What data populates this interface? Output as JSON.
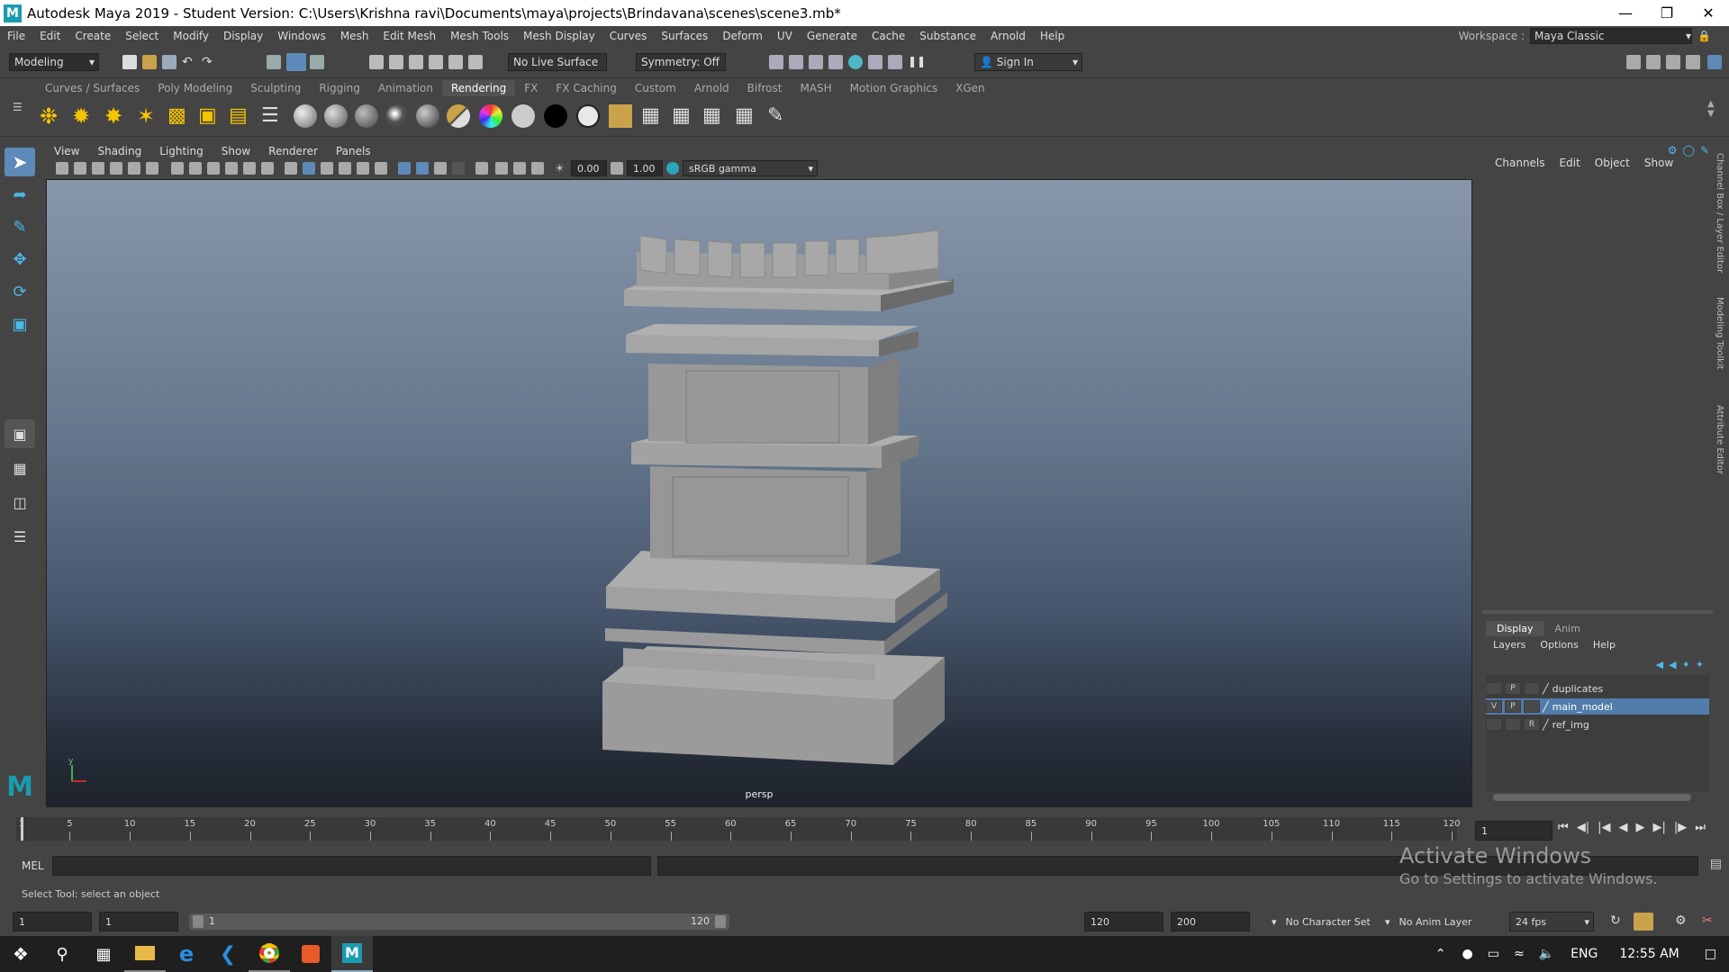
{
  "window": {
    "title": "Autodesk Maya 2019 - Student Version: C:\\Users\\Krishna ravi\\Documents\\maya\\projects\\Brindavana\\scenes\\scene3.mb*",
    "logo": "M"
  },
  "menus": [
    "File",
    "Edit",
    "Create",
    "Select",
    "Modify",
    "Display",
    "Windows",
    "Mesh",
    "Edit Mesh",
    "Mesh Tools",
    "Mesh Display",
    "Curves",
    "Surfaces",
    "Deform",
    "UV",
    "Generate",
    "Cache",
    "Substance",
    "Arnold",
    "Help"
  ],
  "workspace": {
    "label": "Workspace :",
    "value": "Maya Classic"
  },
  "statusline": {
    "mode": "Modeling",
    "live_surface": "No Live Surface",
    "symmetry": "Symmetry: Off",
    "sign_in": "Sign In"
  },
  "shelf_tabs": [
    "Curves / Surfaces",
    "Poly Modeling",
    "Sculpting",
    "Rigging",
    "Animation",
    "Rendering",
    "FX",
    "FX Caching",
    "Custom",
    "Arnold",
    "Bifrost",
    "MASH",
    "Motion Graphics",
    "XGen"
  ],
  "active_shelf": "Rendering",
  "panel_menu": [
    "View",
    "Shading",
    "Lighting",
    "Show",
    "Renderer",
    "Panels"
  ],
  "panel_bar": {
    "exposure": "0.00",
    "gamma": "1.00",
    "color_space": "sRGB gamma"
  },
  "viewport": {
    "camera": "persp"
  },
  "channel_box": {
    "menu": [
      "Channels",
      "Edit",
      "Object",
      "Show"
    ]
  },
  "layer_editor": {
    "tabs": [
      "Display",
      "Anim"
    ],
    "menu": [
      "Layers",
      "Options",
      "Help"
    ],
    "layers": [
      {
        "v": "",
        "p": "P",
        "name": "duplicates"
      },
      {
        "v": "V",
        "p": "P",
        "name": "main_model"
      },
      {
        "v": "",
        "p": "R",
        "name": "ref_img"
      }
    ]
  },
  "side_tabs": [
    "Channel Box / Layer Editor",
    "Modeling Toolkit",
    "Attribute Editor"
  ],
  "timeline": {
    "labels": [
      "1",
      "5",
      "10",
      "15",
      "20",
      "25",
      "30",
      "35",
      "40",
      "45",
      "50",
      "55",
      "60",
      "65",
      "70",
      "75",
      "80",
      "85",
      "90",
      "95",
      "100",
      "105",
      "110",
      "115",
      "120"
    ],
    "current_frame": "1"
  },
  "cmdline": {
    "lang": "MEL"
  },
  "helpline": "Select Tool: select an object",
  "range": {
    "start": "1",
    "start2": "1",
    "slider_start": "1",
    "slider_end": "120",
    "end": "120",
    "end2": "200",
    "character_set": "No Character Set",
    "anim_layer": "No Anim Layer",
    "fps": "24 fps"
  },
  "watermark": {
    "line1": "Activate Windows",
    "line2": "Go to Settings to activate Windows."
  },
  "taskbar": {
    "lang": "ENG",
    "time": "12:55 AM"
  },
  "colors": {
    "accent": "#527cab",
    "maya_teal": "#1a9bb0"
  }
}
